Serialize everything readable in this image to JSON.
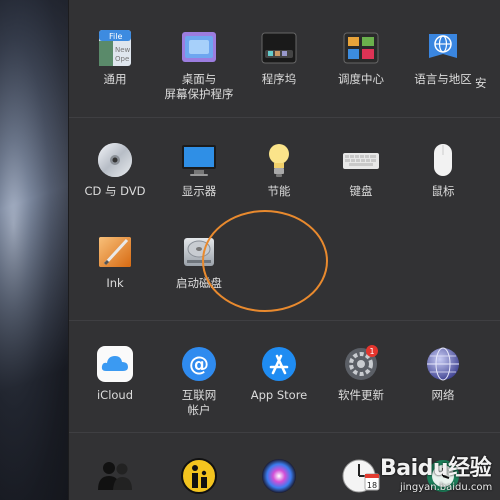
{
  "rows": {
    "personal": [
      {
        "label": "通用",
        "icon": "general-icon",
        "mini_text": [
          "File",
          "New",
          "Ope"
        ]
      },
      {
        "label": "桌面与\n屏幕保护程序",
        "icon": "desktop-screensaver-icon"
      },
      {
        "label": "程序坞",
        "icon": "dock-icon"
      },
      {
        "label": "调度中心",
        "icon": "mission-control-icon"
      },
      {
        "label": "语言与地区",
        "icon": "language-region-icon"
      },
      {
        "label": "安",
        "icon": "security-icon"
      }
    ],
    "hardware": [
      {
        "label": "CD 与 DVD",
        "icon": "cd-dvd-icon"
      },
      {
        "label": "显示器",
        "icon": "displays-icon"
      },
      {
        "label": "节能",
        "icon": "energy-saver-icon"
      },
      {
        "label": "键盘",
        "icon": "keyboard-icon"
      },
      {
        "label": "鼠标",
        "icon": "mouse-icon"
      }
    ],
    "hardware2": [
      {
        "label": "Ink",
        "icon": "ink-icon"
      },
      {
        "label": "启动磁盘",
        "icon": "startup-disk-icon"
      }
    ],
    "internet": [
      {
        "label": "iCloud",
        "icon": "icloud-icon"
      },
      {
        "label": "互联网\n帐户",
        "icon": "internet-accounts-icon"
      },
      {
        "label": "App Store",
        "icon": "app-store-icon"
      },
      {
        "label": "软件更新",
        "icon": "software-update-icon",
        "badge": "1"
      },
      {
        "label": "网络",
        "icon": "network-icon"
      }
    ],
    "system": [
      {
        "label": "",
        "icon": "users-groups-icon"
      },
      {
        "label": "",
        "icon": "parental-controls-icon"
      },
      {
        "label": "",
        "icon": "siri-icon"
      },
      {
        "label": "",
        "icon": "date-time-icon",
        "calendar_day": "18"
      },
      {
        "label": "",
        "icon": "time-machine-icon"
      }
    ]
  },
  "watermark": {
    "text": "Baidu经验",
    "sub": "jingyan.baidu.com"
  },
  "colors": {
    "highlight": "#e98a2e",
    "badge": "#e5352d",
    "window": "#323234"
  }
}
